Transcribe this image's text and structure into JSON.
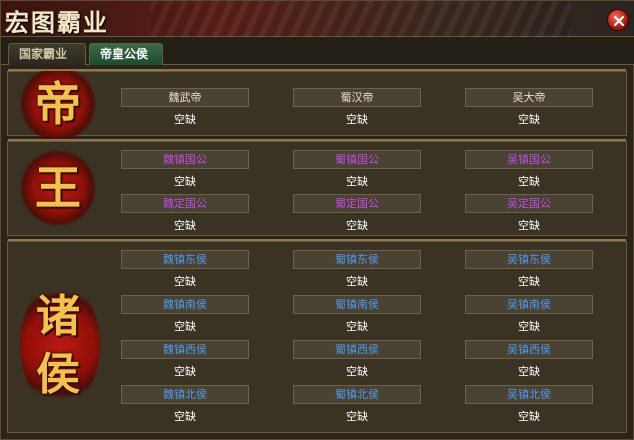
{
  "window": {
    "title": "宏图霸业"
  },
  "tabs": [
    {
      "label": "国家霸业"
    },
    {
      "label": "帝皇公侯"
    }
  ],
  "sections": {
    "emperor": {
      "emblem": "帝",
      "slots": [
        {
          "title": "魏武帝",
          "holder": "空缺"
        },
        {
          "title": "蜀汉帝",
          "holder": "空缺"
        },
        {
          "title": "吴大帝",
          "holder": "空缺"
        }
      ]
    },
    "king": {
      "emblem": "王",
      "slots": [
        {
          "title": "魏镇国公",
          "holder": "空缺"
        },
        {
          "title": "蜀镇国公",
          "holder": "空缺"
        },
        {
          "title": "吴镇国公",
          "holder": "空缺"
        },
        {
          "title": "魏定国公",
          "holder": "空缺"
        },
        {
          "title": "蜀定国公",
          "holder": "空缺"
        },
        {
          "title": "吴定国公",
          "holder": "空缺"
        }
      ]
    },
    "marquis": {
      "emblem": "诸\n侯",
      "slots": [
        {
          "title": "魏镇东侯",
          "holder": "空缺"
        },
        {
          "title": "蜀镇东侯",
          "holder": "空缺"
        },
        {
          "title": "吴镇东侯",
          "holder": "空缺"
        },
        {
          "title": "魏镇南侯",
          "holder": "空缺"
        },
        {
          "title": "蜀镇南侯",
          "holder": "空缺"
        },
        {
          "title": "吴镇南侯",
          "holder": "空缺"
        },
        {
          "title": "魏镇西侯",
          "holder": "空缺"
        },
        {
          "title": "蜀镇西侯",
          "holder": "空缺"
        },
        {
          "title": "吴镇西侯",
          "holder": "空缺"
        },
        {
          "title": "魏镇北侯",
          "holder": "空缺"
        },
        {
          "title": "蜀镇北侯",
          "holder": "空缺"
        },
        {
          "title": "吴镇北侯",
          "holder": "空缺"
        }
      ]
    }
  },
  "colors": {
    "duke_title": "#c24ce6",
    "marquis_title": "#4a9cf0",
    "emblem_red": "#b81a12",
    "emblem_gold": "#f2c24c"
  }
}
